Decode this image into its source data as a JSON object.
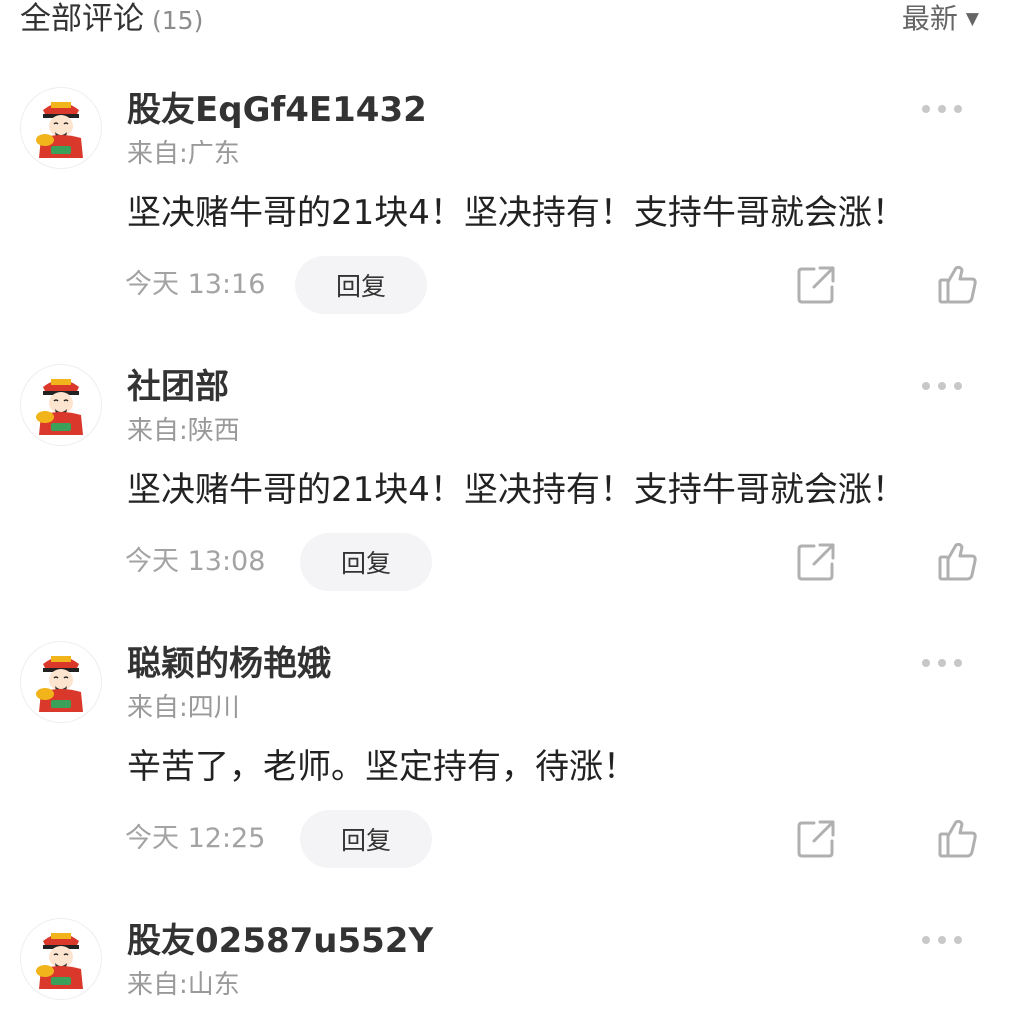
{
  "header": {
    "title": "全部评论",
    "count": "(15)",
    "sort_label": "最新",
    "sort_caret": "▼"
  },
  "comments": [
    {
      "username": "股友EqGf4E1432",
      "location": "来自:广东",
      "content": "坚决赌牛哥的21块4！坚决持有！支持牛哥就会涨！",
      "time": "今天 13:16",
      "reply_label": "回复"
    },
    {
      "username": "社团部",
      "location": "来自:陕西",
      "content": "坚决赌牛哥的21块4！坚决持有！支持牛哥就会涨！",
      "time": "今天 13:08",
      "reply_label": "回复"
    },
    {
      "username": "聪颖的杨艳娥",
      "location": "来自:四川",
      "content": "辛苦了，老师。坚定持有，待涨！",
      "time": "今天 12:25",
      "reply_label": "回复"
    },
    {
      "username": "股友02587u552Y",
      "location": "来自:山东",
      "content": "",
      "time": "",
      "reply_label": ""
    }
  ],
  "icons": {
    "more": "more-dots-icon",
    "share": "share-icon",
    "like": "thumbs-up-icon",
    "avatar": "fortune-god-avatar-icon"
  },
  "colors": {
    "text_primary": "#222222",
    "text_secondary": "#9a9a9a",
    "reply_bg": "#f4f4f6",
    "icon_gray": "#b0b0b0",
    "avatar_red": "#d9382b",
    "avatar_gold": "#f2b41b"
  }
}
